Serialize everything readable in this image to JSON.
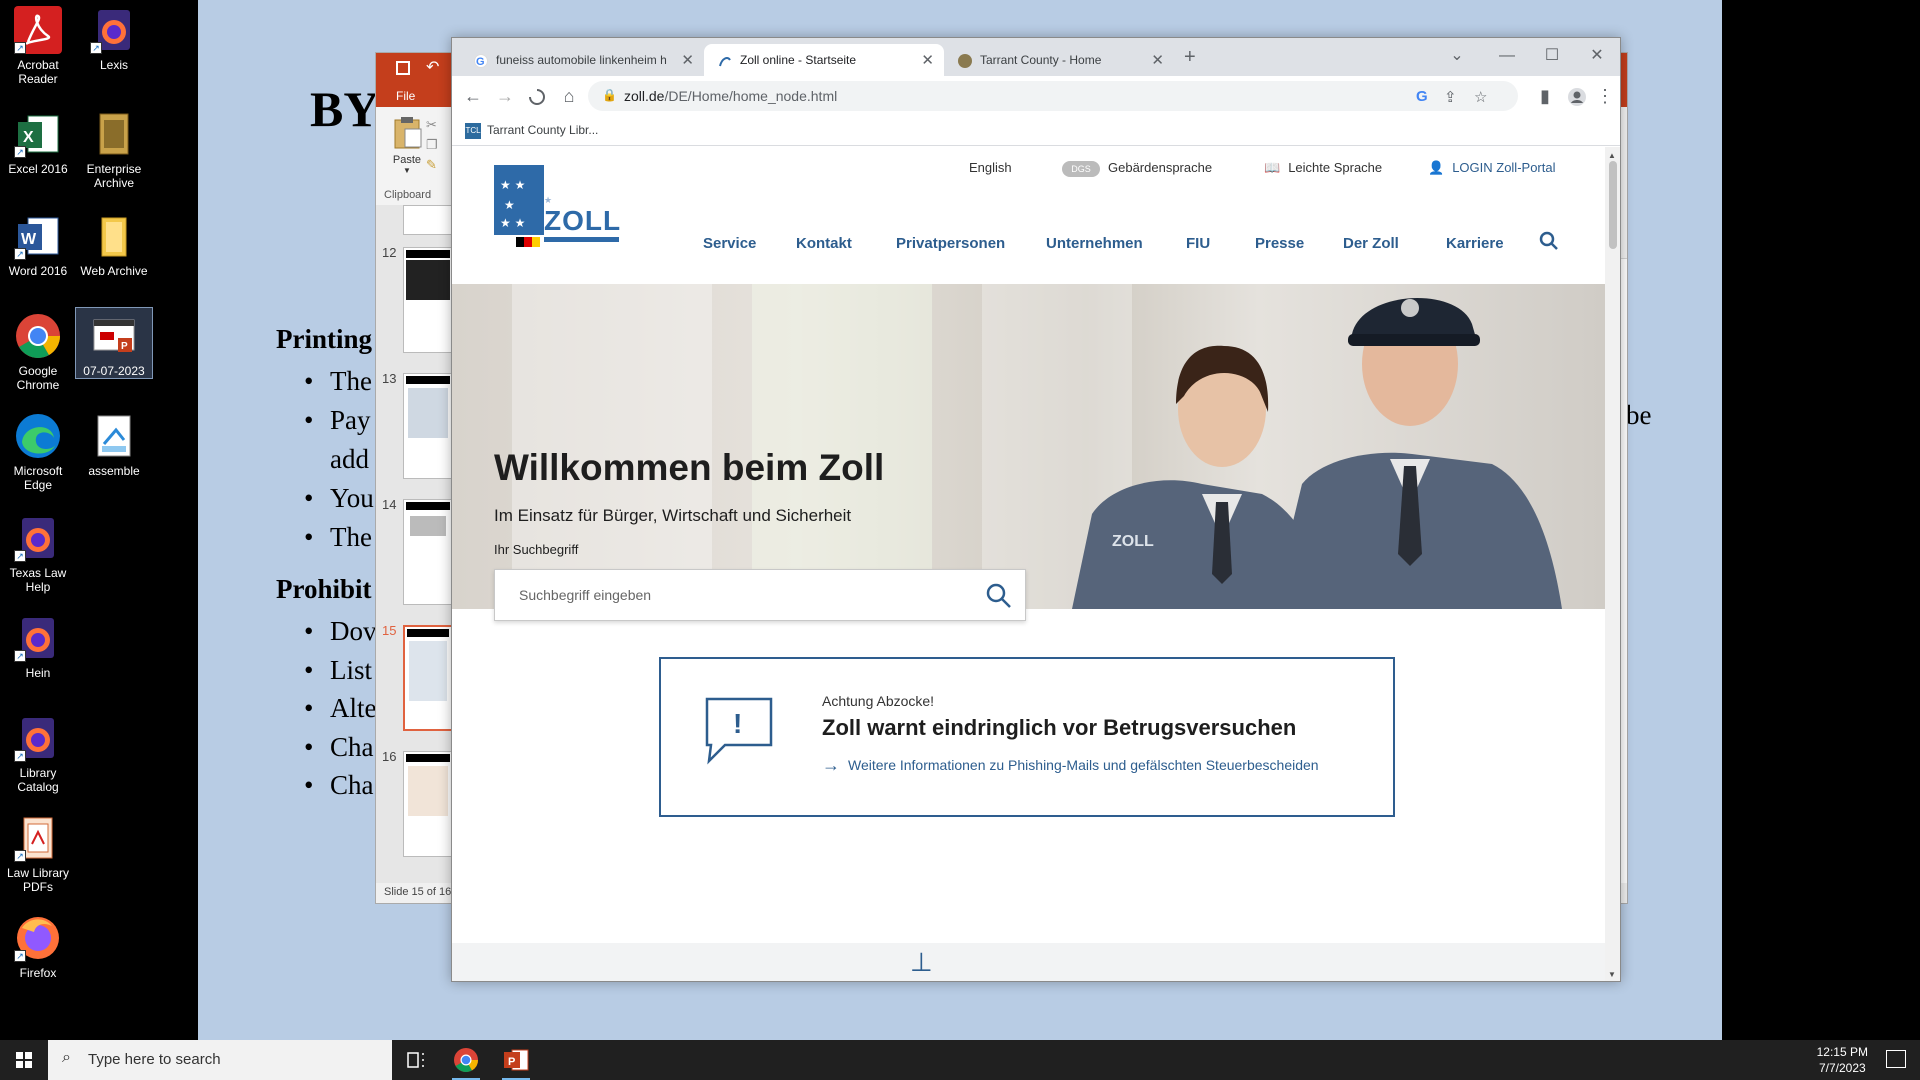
{
  "desktop": {
    "icons": [
      {
        "label": "Acrobat Reader",
        "icon": "acrobat-icon"
      },
      {
        "label": "Lexis",
        "icon": "firefox-icon"
      },
      {
        "label": "Excel 2016",
        "icon": "excel-icon"
      },
      {
        "label": "Enterprise Archive",
        "icon": "archive-icon"
      },
      {
        "label": "Word 2016",
        "icon": "word-icon"
      },
      {
        "label": "Web Archive",
        "icon": "folder-icon"
      },
      {
        "label": "Google Chrome",
        "icon": "chrome-icon"
      },
      {
        "label": "07-07-2023",
        "icon": "powerpoint-file-icon"
      },
      {
        "label": "Microsoft Edge",
        "icon": "edge-icon"
      },
      {
        "label": "assemble",
        "icon": "assemble-icon"
      },
      {
        "label": "Texas Law Help",
        "icon": "firefox-icon"
      },
      {
        "label": "Hein",
        "icon": "firefox-icon"
      },
      {
        "label": "Library Catalog",
        "icon": "firefox-icon"
      },
      {
        "label": "Law Library PDFs",
        "icon": "pdf-folder-icon"
      },
      {
        "label": "Firefox",
        "icon": "firefox-icon"
      }
    ]
  },
  "slide": {
    "title": "BY",
    "heading1": "Printing",
    "bullets1": [
      "The",
      "Pay",
      "add",
      "You",
      "The"
    ],
    "right_fragment": "be",
    "heading2": "Prohibit",
    "bullets2": [
      "Dov",
      "List",
      "Alte",
      "Cha",
      "Cha"
    ]
  },
  "powerpoint": {
    "file_tab": "File",
    "paste_label": "Paste",
    "clipboard_label": "Clipboard",
    "thumb_numbers": [
      "12",
      "13",
      "14",
      "15",
      "16"
    ],
    "active_slide": "15",
    "status": "Slide 15 of 16"
  },
  "browser": {
    "tabs": [
      {
        "title": "funeiss automobile linkenheim h",
        "active": false
      },
      {
        "title": "Zoll online - Startseite",
        "active": true
      },
      {
        "title": "Tarrant County - Home",
        "active": false
      }
    ],
    "new_tab": "+",
    "url_host": "zoll.de",
    "url_path": "/DE/Home/home_node.html",
    "bookmark": "Tarrant County Libr..."
  },
  "site": {
    "logo_text": "ZOLL",
    "meta_links": {
      "english": "English",
      "sign_language": "Gebärdensprache",
      "easy_language": "Leichte Sprache",
      "login": "LOGIN Zoll-Portal"
    },
    "nav": [
      "Service",
      "Kontakt",
      "Privatpersonen",
      "Unternehmen",
      "FIU",
      "Presse",
      "Der Zoll",
      "Karriere"
    ],
    "hero": {
      "title": "Willkommen beim Zoll",
      "subtitle": "Im Einsatz für Bürger, Wirtschaft und Sicherheit",
      "search_label": "Ihr Suchbegriff",
      "search_placeholder": "Suchbegriff eingeben"
    },
    "alert": {
      "kicker": "Achtung Abzocke!",
      "title": "Zoll warnt eindringlich vor Betrugsversuchen",
      "link": "Weitere Informationen zu Phishing-Mails und gefälschten Steuerbescheiden"
    }
  },
  "taskbar": {
    "search_placeholder": "Type here to search",
    "time": "12:15 PM",
    "date": "7/7/2023"
  },
  "colors": {
    "zoll_blue": "#2e6aa8",
    "nav_blue": "#2d5d8e",
    "ppt_red": "#c43e1c",
    "slide_bg": "#b8cce4"
  }
}
